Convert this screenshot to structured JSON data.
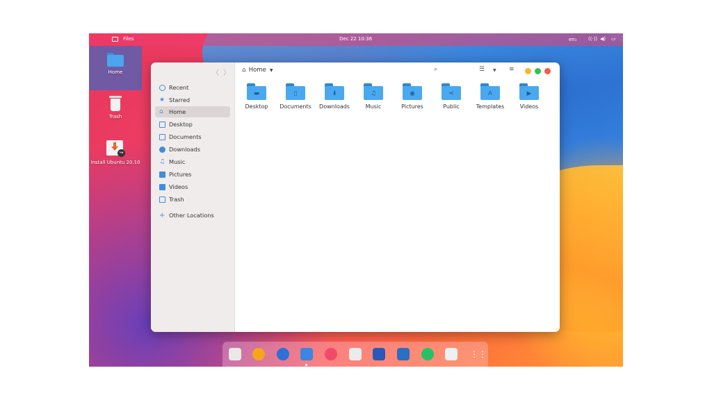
{
  "topbar": {
    "app_name": "Files",
    "clock": "Dec 22  10:36",
    "lang": "en₁"
  },
  "desktop_icons": [
    {
      "label": "Home"
    },
    {
      "label": "Trash"
    },
    {
      "label": "Install Ubuntu 20.10"
    }
  ],
  "window": {
    "path": "Home",
    "sidebar": {
      "items": [
        {
          "label": "Recent",
          "icon": "clock-icon"
        },
        {
          "label": "Starred",
          "icon": "star-icon"
        },
        {
          "label": "Home",
          "icon": "home-icon",
          "active": true
        },
        {
          "label": "Desktop",
          "icon": "desktop-icon"
        },
        {
          "label": "Documents",
          "icon": "document-icon"
        },
        {
          "label": "Downloads",
          "icon": "download-icon"
        },
        {
          "label": "Music",
          "icon": "music-icon"
        },
        {
          "label": "Pictures",
          "icon": "camera-icon"
        },
        {
          "label": "Videos",
          "icon": "video-icon"
        },
        {
          "label": "Trash",
          "icon": "trash-icon"
        }
      ],
      "other_locations": "Other Locations"
    },
    "folders": [
      {
        "name": "Desktop",
        "icon": "desktop-folder-icon"
      },
      {
        "name": "Documents",
        "icon": "documents-folder-icon"
      },
      {
        "name": "Downloads",
        "icon": "downloads-folder-icon"
      },
      {
        "name": "Music",
        "icon": "music-folder-icon"
      },
      {
        "name": "Pictures",
        "icon": "pictures-folder-icon"
      },
      {
        "name": "Public",
        "icon": "public-folder-icon"
      },
      {
        "name": "Templates",
        "icon": "templates-folder-icon"
      },
      {
        "name": "Videos",
        "icon": "videos-folder-icon"
      }
    ]
  },
  "colors": {
    "accent": "#3f8ddc",
    "close": "#f05a4f",
    "maximize": "#2fc454",
    "minimize": "#f8b62a"
  },
  "dock": [
    "installer-icon",
    "music-player-icon",
    "browser-icon",
    "files-icon",
    "itunes-icon",
    "screenshot-icon",
    "writer-icon",
    "tweaks-icon",
    "app-store-icon",
    "trash-icon",
    "app-grid-icon"
  ]
}
